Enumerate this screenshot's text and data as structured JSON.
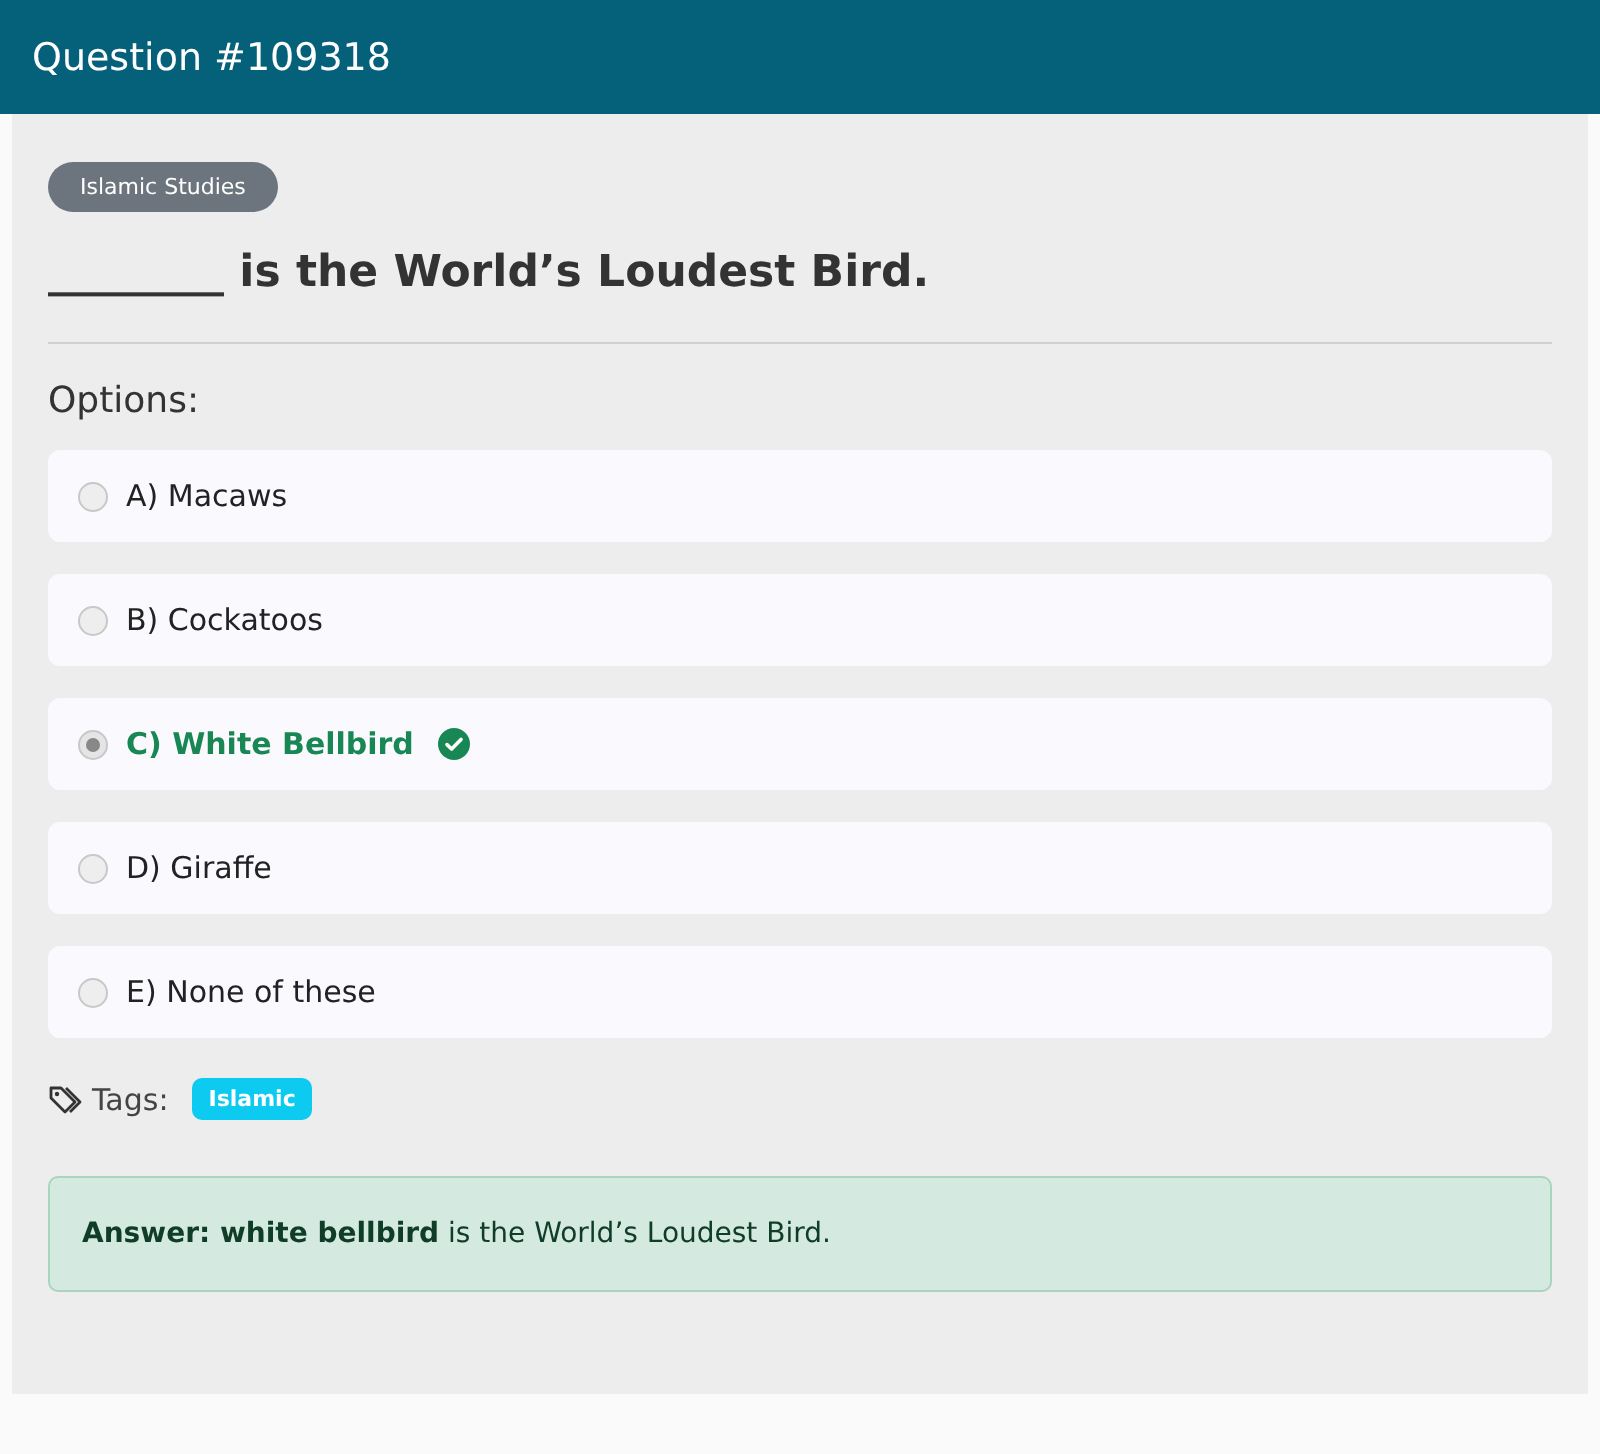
{
  "header": {
    "title": "Question #109318"
  },
  "category": "Islamic Studies",
  "question": "________ is the World’s Loudest Bird.",
  "options_label": "Options:",
  "options": [
    {
      "label": "A) Macaws",
      "selected": false,
      "correct": false
    },
    {
      "label": "B) Cockatoos",
      "selected": false,
      "correct": false
    },
    {
      "label": "C) White Bellbird",
      "selected": true,
      "correct": true
    },
    {
      "label": "D) Giraffe",
      "selected": false,
      "correct": false
    },
    {
      "label": "E) None of these",
      "selected": false,
      "correct": false
    }
  ],
  "tags_label": "Tags:",
  "tags": [
    "Islamic"
  ],
  "answer": "**Answer: white bellbird** is the World’s Loudest Bird."
}
